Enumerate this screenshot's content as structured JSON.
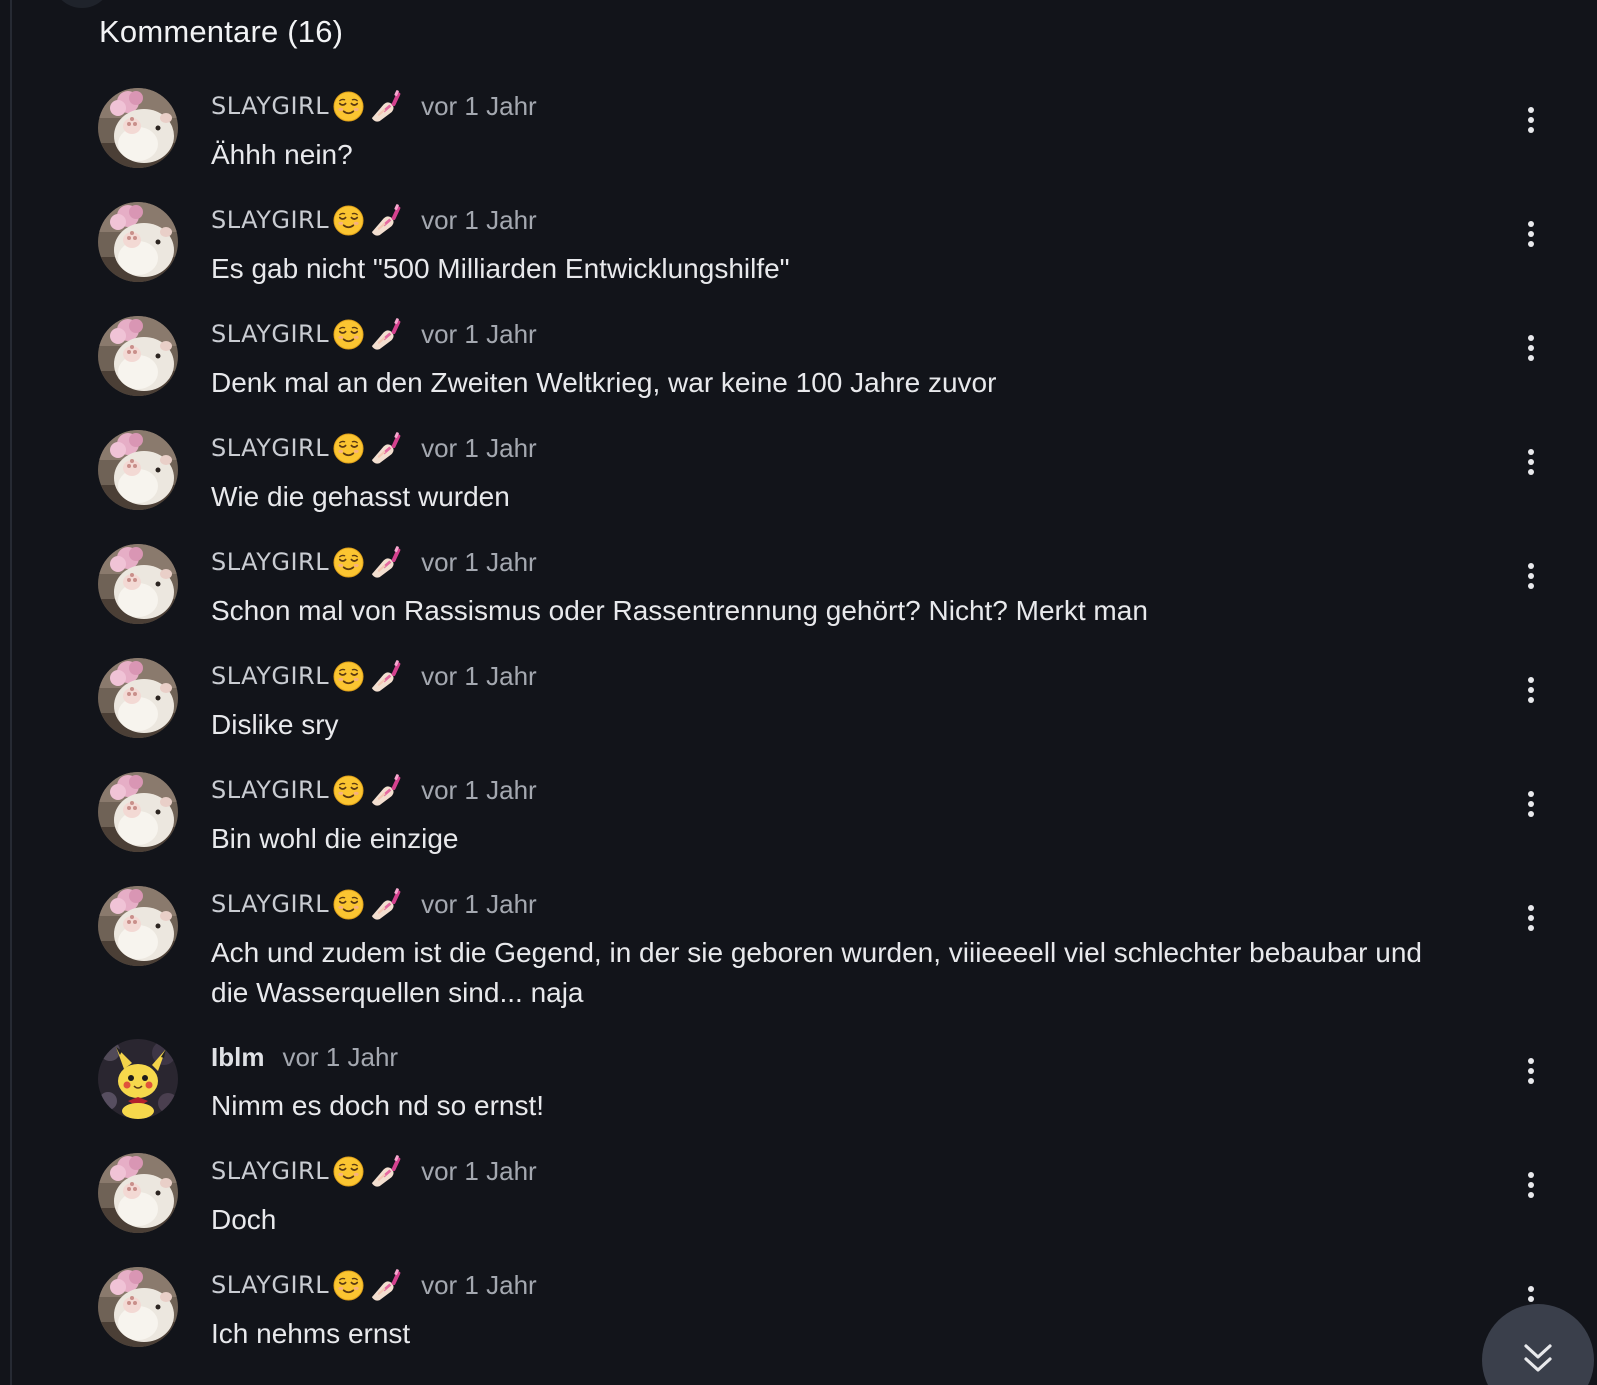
{
  "section": {
    "title": "Kommentare (16)"
  },
  "icons": {
    "more": "more-vertical-icon",
    "scroll": "chevron-double-down-icon",
    "face_emoji": "relieved-face-emoji",
    "nail_emoji": "nail-polish-emoji"
  },
  "colors": {
    "background": "#12141a",
    "text": "#e8e9ec",
    "muted": "#a4a8b0",
    "scroll_button": "#3a3f4b"
  },
  "comments": [
    {
      "author": "SLAYGIRL",
      "avatar": "hamster",
      "has_emojis": true,
      "time": "vor 1 Jahr",
      "text": "Ähhh nein?"
    },
    {
      "author": "SLAYGIRL",
      "avatar": "hamster",
      "has_emojis": true,
      "time": "vor 1 Jahr",
      "text": "Es gab nicht \"500 Milliarden Entwicklungshilfe\""
    },
    {
      "author": "SLAYGIRL",
      "avatar": "hamster",
      "has_emojis": true,
      "time": "vor 1 Jahr",
      "text": "Denk mal an den Zweiten Weltkrieg, war keine 100 Jahre zuvor"
    },
    {
      "author": "SLAYGIRL",
      "avatar": "hamster",
      "has_emojis": true,
      "time": "vor 1 Jahr",
      "text": "Wie die gehasst wurden"
    },
    {
      "author": "SLAYGIRL",
      "avatar": "hamster",
      "has_emojis": true,
      "time": "vor 1 Jahr",
      "text": "Schon mal von Rassismus oder Rassentrennung gehört? Nicht? Merkt man"
    },
    {
      "author": "SLAYGIRL",
      "avatar": "hamster",
      "has_emojis": true,
      "time": "vor 1 Jahr",
      "text": "Dislike sry"
    },
    {
      "author": "SLAYGIRL",
      "avatar": "hamster",
      "has_emojis": true,
      "time": "vor 1 Jahr",
      "text": "Bin wohl die einzige"
    },
    {
      "author": "SLAYGIRL",
      "avatar": "hamster",
      "has_emojis": true,
      "time": "vor 1 Jahr",
      "text": "Ach und zudem ist die Gegend, in der sie geboren wurden, viiieeeell viel schlechter bebaubar und die Wasserquellen sind... naja"
    },
    {
      "author": "Iblm",
      "avatar": "pikachu",
      "has_emojis": false,
      "time": "vor 1 Jahr",
      "text": "Nimm es doch nd so ernst!"
    },
    {
      "author": "SLAYGIRL",
      "avatar": "hamster",
      "has_emojis": true,
      "time": "vor 1 Jahr",
      "text": "Doch"
    },
    {
      "author": "SLAYGIRL",
      "avatar": "hamster",
      "has_emojis": true,
      "time": "vor 1 Jahr",
      "text": "Ich nehms ernst"
    }
  ]
}
